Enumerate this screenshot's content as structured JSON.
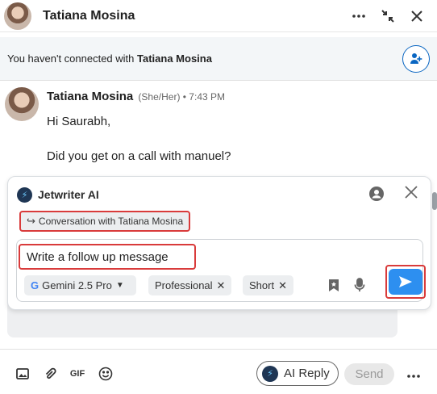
{
  "header": {
    "contact_name": "Tatiana Mosina",
    "more_icon": "ellipsis-icon",
    "minimize_icon": "collapse-icon",
    "close_icon": "close-icon"
  },
  "banner": {
    "text_prefix": "You haven't connected with ",
    "text_name": "Tatiana Mosina",
    "button_icon": "add-connection-icon"
  },
  "message": {
    "sender": "Tatiana Mosina",
    "meta": "(She/Her) • 7:43 PM",
    "lines": [
      "Hi Saurabh,",
      "Did you get on a call with manuel?"
    ]
  },
  "jetwriter": {
    "title": "Jetwriter AI",
    "context_label": "Conversation with Tatiana Mosina",
    "prompt": "Write a follow up message",
    "model": "Gemini 2.5 Pro",
    "tone_chip": "Professional",
    "length_chip": "Short"
  },
  "footer": {
    "ai_reply_label": "AI Reply",
    "send_label": "Send",
    "gif_label": "GIF"
  },
  "colors": {
    "accent_blue": "#2d8ff0",
    "highlight_red": "#d93b3b",
    "linkedin_blue": "#0a66c2"
  }
}
